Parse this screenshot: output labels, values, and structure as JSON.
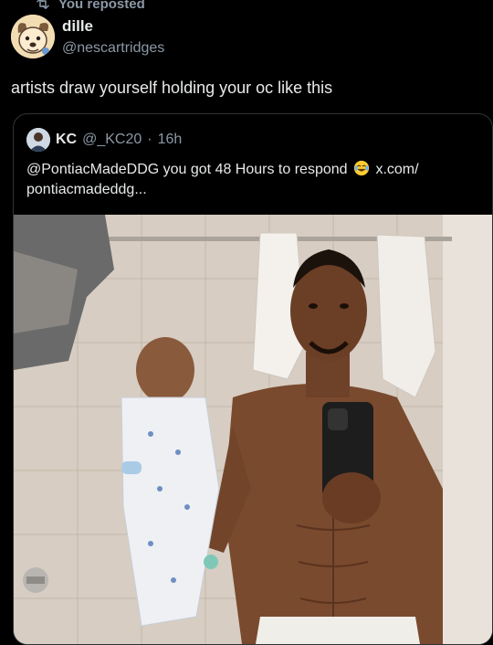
{
  "repost": {
    "label": "You reposted",
    "icon": "repost-icon"
  },
  "post": {
    "display_name": "dille",
    "handle": "@nescartridges",
    "text": "artists draw yourself holding your oc like this",
    "avatar": "cartoon-dog-avatar"
  },
  "quote": {
    "display_name": "KC",
    "handle": "@_KC20",
    "separator": "·",
    "time": "16h",
    "text_before_emoji": "@PontiacMadeDDG you got 48 Hours to respond",
    "emoji": "laughing-crying-emoji",
    "text_after_emoji": "x.com/ pontiacmadeddg...",
    "media": {
      "type": "photo",
      "description_icon": "mirror-selfie-photo"
    }
  },
  "colors": {
    "background": "#000000",
    "text_primary": "#e7e9ea",
    "text_secondary": "#8b98a5",
    "border": "#2f3336"
  }
}
